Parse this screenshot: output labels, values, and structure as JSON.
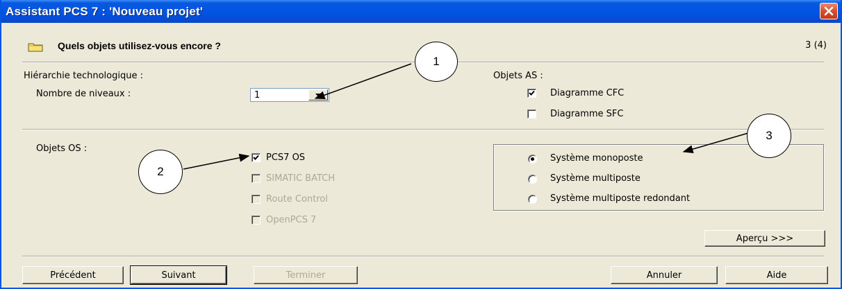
{
  "window": {
    "title": "Assistant PCS 7 : 'Nouveau projet'"
  },
  "header": {
    "question": "Quels objets utilisez-vous encore ?",
    "step": "3 (4)"
  },
  "hierarchy": {
    "section_label": "Hiérarchie technologique :",
    "levels_label": "Nombre de niveaux :",
    "levels_value": "1"
  },
  "as_objects": {
    "section_label": "Objets AS :",
    "items": [
      {
        "label": "Diagramme CFC",
        "checked": true,
        "enabled": true
      },
      {
        "label": "Diagramme SFC",
        "checked": false,
        "enabled": true
      }
    ]
  },
  "os_objects": {
    "section_label": "Objets OS :",
    "items": [
      {
        "label": "PCS7 OS",
        "checked": true,
        "enabled": true
      },
      {
        "label": "SIMATIC BATCH",
        "checked": false,
        "enabled": false
      },
      {
        "label": "Route Control",
        "checked": false,
        "enabled": false
      },
      {
        "label": "OpenPCS 7",
        "checked": false,
        "enabled": false
      }
    ]
  },
  "system_type": {
    "options": [
      {
        "label": "Système monoposte",
        "selected": true
      },
      {
        "label": "Système multiposte",
        "selected": false
      },
      {
        "label": "Système multiposte redondant",
        "selected": false
      }
    ]
  },
  "buttons": {
    "preview": "Aperçu >>>",
    "previous": "Précédent",
    "next": "Suivant",
    "finish": "Terminer",
    "cancel": "Annuler",
    "help": "Aide"
  },
  "callouts": [
    "1",
    "2",
    "3"
  ],
  "colors": {
    "titlebar": "#0054e3",
    "dialog_bg": "#ece9d8",
    "close_button": "#d6502f",
    "disabled_text": "#aca899"
  }
}
